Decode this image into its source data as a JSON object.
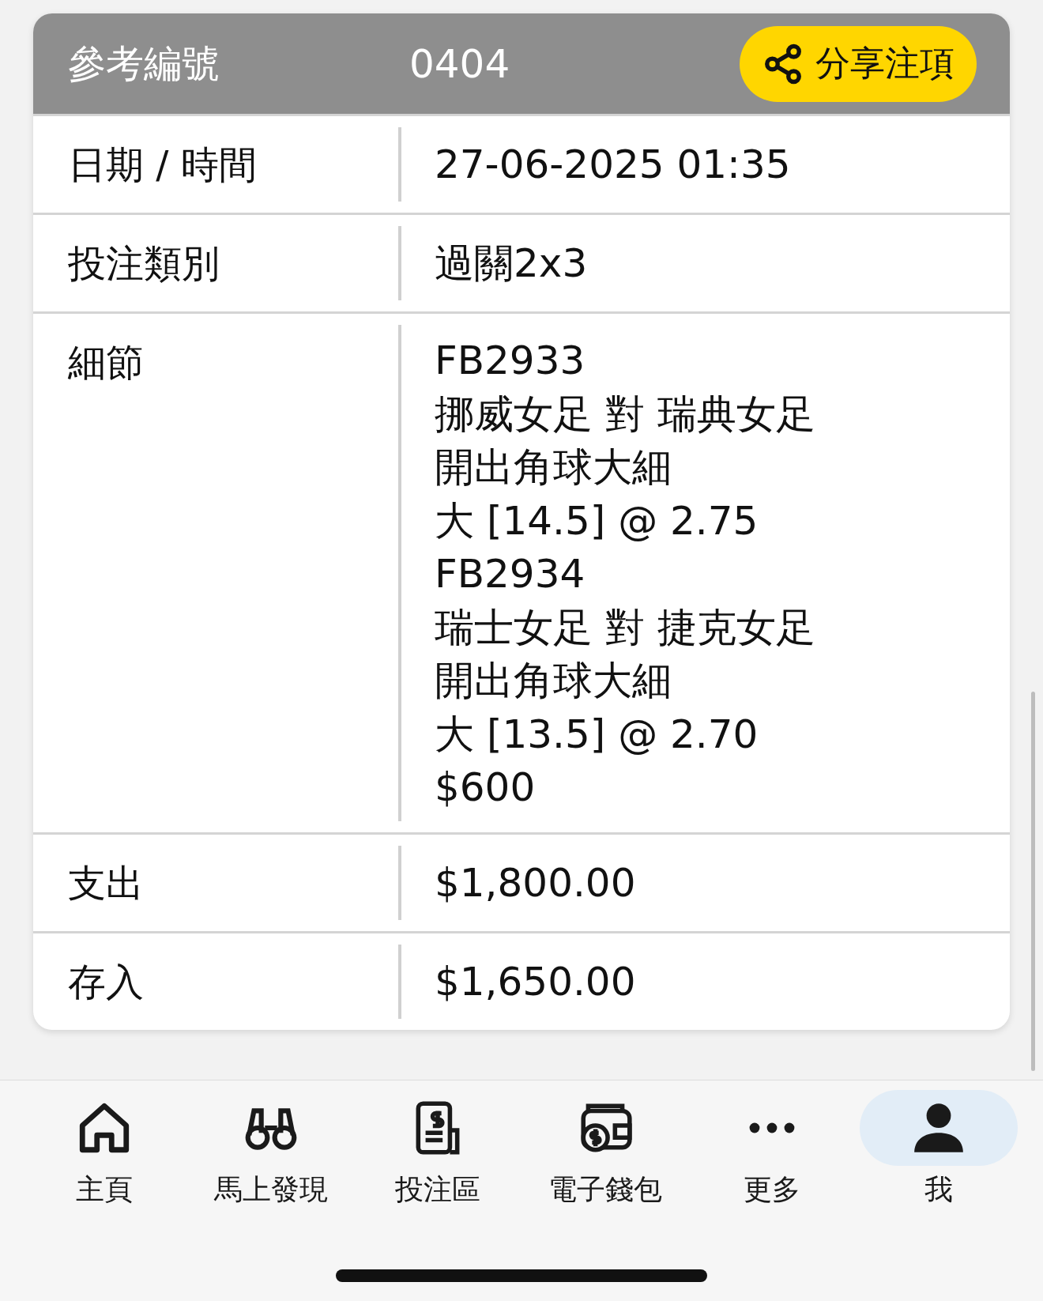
{
  "header": {
    "label": "參考編號",
    "value": "0404",
    "share_button": "分享注項"
  },
  "rows": [
    {
      "kind": "single",
      "label": "日期 / 時間",
      "value": "27-06-2025 01:35"
    },
    {
      "kind": "single",
      "label": "投注類別",
      "value": "過關2x3"
    },
    {
      "kind": "lines",
      "label": "細節",
      "lines": [
        "FB2933",
        "挪威女足 對 瑞典女足",
        "開出角球大細",
        "大 [14.5] @ 2.75",
        "FB2934",
        "瑞士女足 對 捷克女足",
        "開出角球大細",
        "大 [13.5] @ 2.70",
        "$600"
      ]
    },
    {
      "kind": "single",
      "label": "支出",
      "value": "$1,800.00"
    },
    {
      "kind": "single",
      "label": "存入",
      "value": "$1,650.00"
    }
  ],
  "nav": [
    {
      "kind": "home",
      "label": "主頁",
      "selected": false
    },
    {
      "kind": "binoculars",
      "label": "馬上發現",
      "selected": false
    },
    {
      "kind": "slip",
      "label": "投注區",
      "selected": false
    },
    {
      "kind": "wallet",
      "label": "電子錢包",
      "selected": false
    },
    {
      "kind": "more",
      "label": "更多",
      "selected": false
    },
    {
      "kind": "user",
      "label": "我",
      "selected": true
    }
  ]
}
